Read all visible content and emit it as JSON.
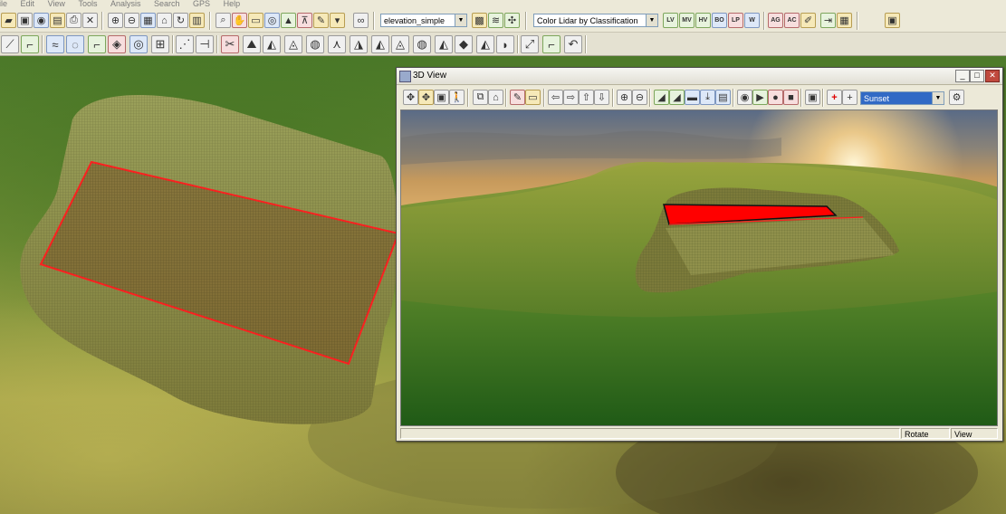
{
  "menubar": {
    "items": [
      "ile",
      "Edit",
      "View",
      "Tools",
      "Analysis",
      "Search",
      "GPS",
      "Help"
    ]
  },
  "toolbar1": {
    "layer_dropdown": {
      "selected": "elevation_simple"
    },
    "lidar_dropdown": {
      "selected": "Color Lidar by Classification"
    },
    "button_labels": [
      "LV",
      "MV",
      "HV",
      "BO",
      "LP",
      "W",
      "AG",
      "AC"
    ]
  },
  "window3d": {
    "title": "3D View",
    "controls": {
      "minimize": "_",
      "maximize": "□",
      "close": "✕"
    },
    "sky_dropdown": {
      "selected": "Sunset"
    },
    "status": {
      "mode": "Rotate",
      "view": "View"
    }
  },
  "colors": {
    "toolbar_bg": "#ece9d8",
    "selection_outline": "#ff2020",
    "building_fill": "#ff0000",
    "terrain_green": "#5e8a2c",
    "terrain_yellow": "#b3a94a"
  }
}
